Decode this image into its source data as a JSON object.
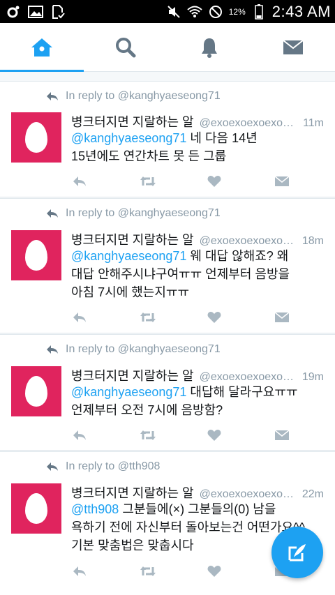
{
  "status_bar": {
    "battery_percent": "12%",
    "time": "2:43 AM",
    "left_icons": [
      "sync-icon",
      "image-icon",
      "download-check-icon"
    ],
    "right_icons": [
      "mute-icon",
      "wifi-icon",
      "do-not-disturb-icon",
      "battery-icon"
    ]
  },
  "tabs": [
    {
      "name": "home",
      "icon": "home-icon",
      "active": true
    },
    {
      "name": "search",
      "icon": "search-icon",
      "active": false
    },
    {
      "name": "notifications",
      "icon": "bell-icon",
      "active": false
    },
    {
      "name": "messages",
      "icon": "envelope-icon",
      "active": false
    }
  ],
  "colors": {
    "accent": "#1da1f2",
    "avatar_bg": "#e0245e",
    "muted": "#8899a6",
    "text": "#14171a"
  },
  "tweets": [
    {
      "reply_to": "In reply to @kanghyaeseong71",
      "name": "병크터지면 지랄하는 알",
      "handle": "@exoexoexoexoexo",
      "time": "11m",
      "mention": "@kanghyaeseong71",
      "text_line1": " 네 다음 14년",
      "text_line2": "15년에도 연간차트 못 든 그룹",
      "text_line3": ""
    },
    {
      "reply_to": "In reply to @kanghyaeseong71",
      "name": "병크터지면 지랄하는 알",
      "handle": "@exoexoexoexoexo",
      "time": "18m",
      "mention": "@kanghyaeseong71",
      "text_line1": " 웨 대답 않해죠? 왜",
      "text_line2": "대답 안해주시냐구여ㅠㅠ 언제부터 음방을",
      "text_line3": "아침 7시에 했는지ㅠㅠ"
    },
    {
      "reply_to": "In reply to @kanghyaeseong71",
      "name": "병크터지면 지랄하는 알",
      "handle": "@exoexoexoexoexo",
      "time": "19m",
      "mention": "@kanghyaeseong71",
      "text_line1": " 대답해 달라구요ㅠㅠ",
      "text_line2": "언제부터 오전 7시에 음방함?",
      "text_line3": ""
    },
    {
      "reply_to": "In reply to @tth908",
      "name": "병크터지면 지랄하는 알",
      "handle": "@exoexoexoexoexo",
      "time": "22m",
      "mention": "@tth908",
      "text_line1": "  그분들에(×) 그분들의(0) 남을",
      "text_line2": "욕하기 전에 자신부터 돌아보는건 어떤가요^^",
      "text_line3": "기본 맞춤법은 맞춥시다"
    }
  ]
}
